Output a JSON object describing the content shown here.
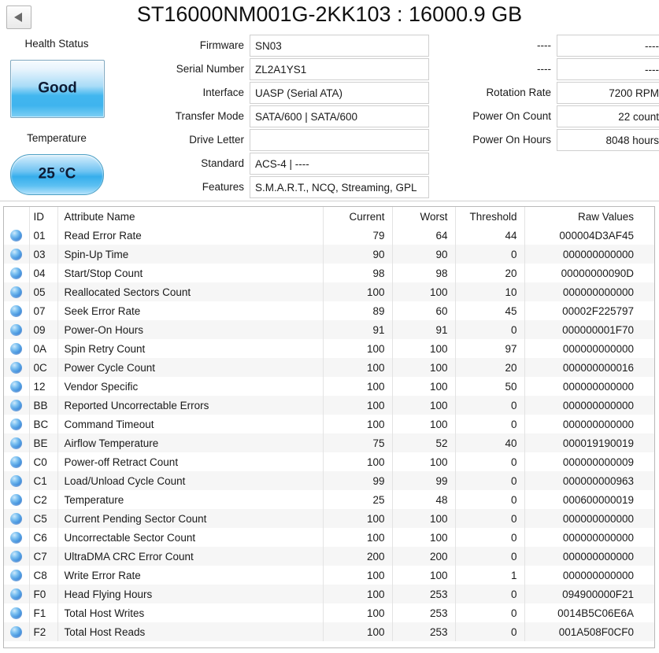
{
  "window": {
    "title": "ST16000NM001G-2KK103 : 16000.9 GB",
    "back_icon": "back-arrow-icon"
  },
  "status": {
    "health_label": "Health Status",
    "health_value": "Good",
    "health_color": "#41b6ef",
    "temperature_label": "Temperature",
    "temperature_value": "25 °C",
    "temperature_color": "#36aeec"
  },
  "info_left": [
    {
      "label": "Firmware",
      "value": "SN03"
    },
    {
      "label": "Serial Number",
      "value": "ZL2A1YS1"
    },
    {
      "label": "Interface",
      "value": "UASP (Serial ATA)"
    },
    {
      "label": "Transfer Mode",
      "value": "SATA/600 | SATA/600"
    },
    {
      "label": "Drive Letter",
      "value": ""
    },
    {
      "label": "Standard",
      "value": "ACS-4 | ----"
    },
    {
      "label": "Features",
      "value": "S.M.A.R.T., NCQ, Streaming, GPL"
    }
  ],
  "info_right": [
    {
      "label": "----",
      "value": "----"
    },
    {
      "label": "----",
      "value": "----"
    },
    {
      "label": "Rotation Rate",
      "value": "7200 RPM"
    },
    {
      "label": "Power On Count",
      "value": "22 count"
    },
    {
      "label": "Power On Hours",
      "value": "8048 hours"
    }
  ],
  "table": {
    "columns": [
      "",
      "ID",
      "Attribute Name",
      "Current",
      "Worst",
      "Threshold",
      "Raw Values"
    ],
    "rows": [
      {
        "dot": "blue-sphere-icon",
        "id": "01",
        "name": "Read Error Rate",
        "current": "79",
        "worst": "64",
        "threshold": "44",
        "raw": "000004D3AF45"
      },
      {
        "dot": "blue-sphere-icon",
        "id": "03",
        "name": "Spin-Up Time",
        "current": "90",
        "worst": "90",
        "threshold": "0",
        "raw": "000000000000"
      },
      {
        "dot": "blue-sphere-icon",
        "id": "04",
        "name": "Start/Stop Count",
        "current": "98",
        "worst": "98",
        "threshold": "20",
        "raw": "00000000090D"
      },
      {
        "dot": "blue-sphere-icon",
        "id": "05",
        "name": "Reallocated Sectors Count",
        "current": "100",
        "worst": "100",
        "threshold": "10",
        "raw": "000000000000"
      },
      {
        "dot": "blue-sphere-icon",
        "id": "07",
        "name": "Seek Error Rate",
        "current": "89",
        "worst": "60",
        "threshold": "45",
        "raw": "00002F225797"
      },
      {
        "dot": "blue-sphere-icon",
        "id": "09",
        "name": "Power-On Hours",
        "current": "91",
        "worst": "91",
        "threshold": "0",
        "raw": "000000001F70"
      },
      {
        "dot": "blue-sphere-icon",
        "id": "0A",
        "name": "Spin Retry Count",
        "current": "100",
        "worst": "100",
        "threshold": "97",
        "raw": "000000000000"
      },
      {
        "dot": "blue-sphere-icon",
        "id": "0C",
        "name": "Power Cycle Count",
        "current": "100",
        "worst": "100",
        "threshold": "20",
        "raw": "000000000016"
      },
      {
        "dot": "blue-sphere-icon",
        "id": "12",
        "name": "Vendor Specific",
        "current": "100",
        "worst": "100",
        "threshold": "50",
        "raw": "000000000000"
      },
      {
        "dot": "blue-sphere-icon",
        "id": "BB",
        "name": "Reported Uncorrectable Errors",
        "current": "100",
        "worst": "100",
        "threshold": "0",
        "raw": "000000000000"
      },
      {
        "dot": "blue-sphere-icon",
        "id": "BC",
        "name": "Command Timeout",
        "current": "100",
        "worst": "100",
        "threshold": "0",
        "raw": "000000000000"
      },
      {
        "dot": "blue-sphere-icon",
        "id": "BE",
        "name": "Airflow Temperature",
        "current": "75",
        "worst": "52",
        "threshold": "40",
        "raw": "000019190019"
      },
      {
        "dot": "blue-sphere-icon",
        "id": "C0",
        "name": "Power-off Retract Count",
        "current": "100",
        "worst": "100",
        "threshold": "0",
        "raw": "000000000009"
      },
      {
        "dot": "blue-sphere-icon",
        "id": "C1",
        "name": "Load/Unload Cycle Count",
        "current": "99",
        "worst": "99",
        "threshold": "0",
        "raw": "000000000963"
      },
      {
        "dot": "blue-sphere-icon",
        "id": "C2",
        "name": "Temperature",
        "current": "25",
        "worst": "48",
        "threshold": "0",
        "raw": "000600000019"
      },
      {
        "dot": "blue-sphere-icon",
        "id": "C5",
        "name": "Current Pending Sector Count",
        "current": "100",
        "worst": "100",
        "threshold": "0",
        "raw": "000000000000"
      },
      {
        "dot": "blue-sphere-icon",
        "id": "C6",
        "name": "Uncorrectable Sector Count",
        "current": "100",
        "worst": "100",
        "threshold": "0",
        "raw": "000000000000"
      },
      {
        "dot": "blue-sphere-icon",
        "id": "C7",
        "name": "UltraDMA CRC Error Count",
        "current": "200",
        "worst": "200",
        "threshold": "0",
        "raw": "000000000000"
      },
      {
        "dot": "blue-sphere-icon",
        "id": "C8",
        "name": "Write Error Rate",
        "current": "100",
        "worst": "100",
        "threshold": "1",
        "raw": "000000000000"
      },
      {
        "dot": "blue-sphere-icon",
        "id": "F0",
        "name": "Head Flying Hours",
        "current": "100",
        "worst": "253",
        "threshold": "0",
        "raw": "094900000F21"
      },
      {
        "dot": "blue-sphere-icon",
        "id": "F1",
        "name": "Total Host Writes",
        "current": "100",
        "worst": "253",
        "threshold": "0",
        "raw": "0014B5C06E6A"
      },
      {
        "dot": "blue-sphere-icon",
        "id": "F2",
        "name": "Total Host Reads",
        "current": "100",
        "worst": "253",
        "threshold": "0",
        "raw": "001A508F0CF0"
      }
    ]
  }
}
